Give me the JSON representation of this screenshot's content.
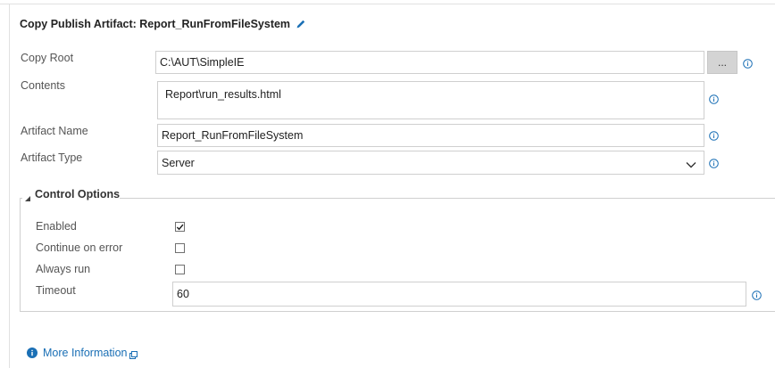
{
  "header": {
    "title": "Copy Publish Artifact: Report_RunFromFileSystem",
    "edit_icon": "pencil-icon"
  },
  "form": {
    "copy_root": {
      "label": "Copy Root",
      "value": "C:\\AUT\\SimpleIE",
      "browse_label": "..."
    },
    "contents": {
      "label": "Contents",
      "value": "Report\\run_results.html"
    },
    "artifact_name": {
      "label": "Artifact Name",
      "value": "Report_RunFromFileSystem"
    },
    "artifact_type": {
      "label": "Artifact Type",
      "value": "Server"
    }
  },
  "control_options": {
    "title": "Control Options",
    "enabled": {
      "label": "Enabled",
      "checked": true
    },
    "continue_on_error": {
      "label": "Continue on error",
      "checked": false
    },
    "always_run": {
      "label": "Always run",
      "checked": false
    },
    "timeout": {
      "label": "Timeout",
      "value": "60"
    }
  },
  "footer": {
    "more_info": "More Information"
  },
  "colors": {
    "accent": "#1a6fb5",
    "border": "#cfcfcf",
    "button_bg": "#d4d4d4"
  }
}
